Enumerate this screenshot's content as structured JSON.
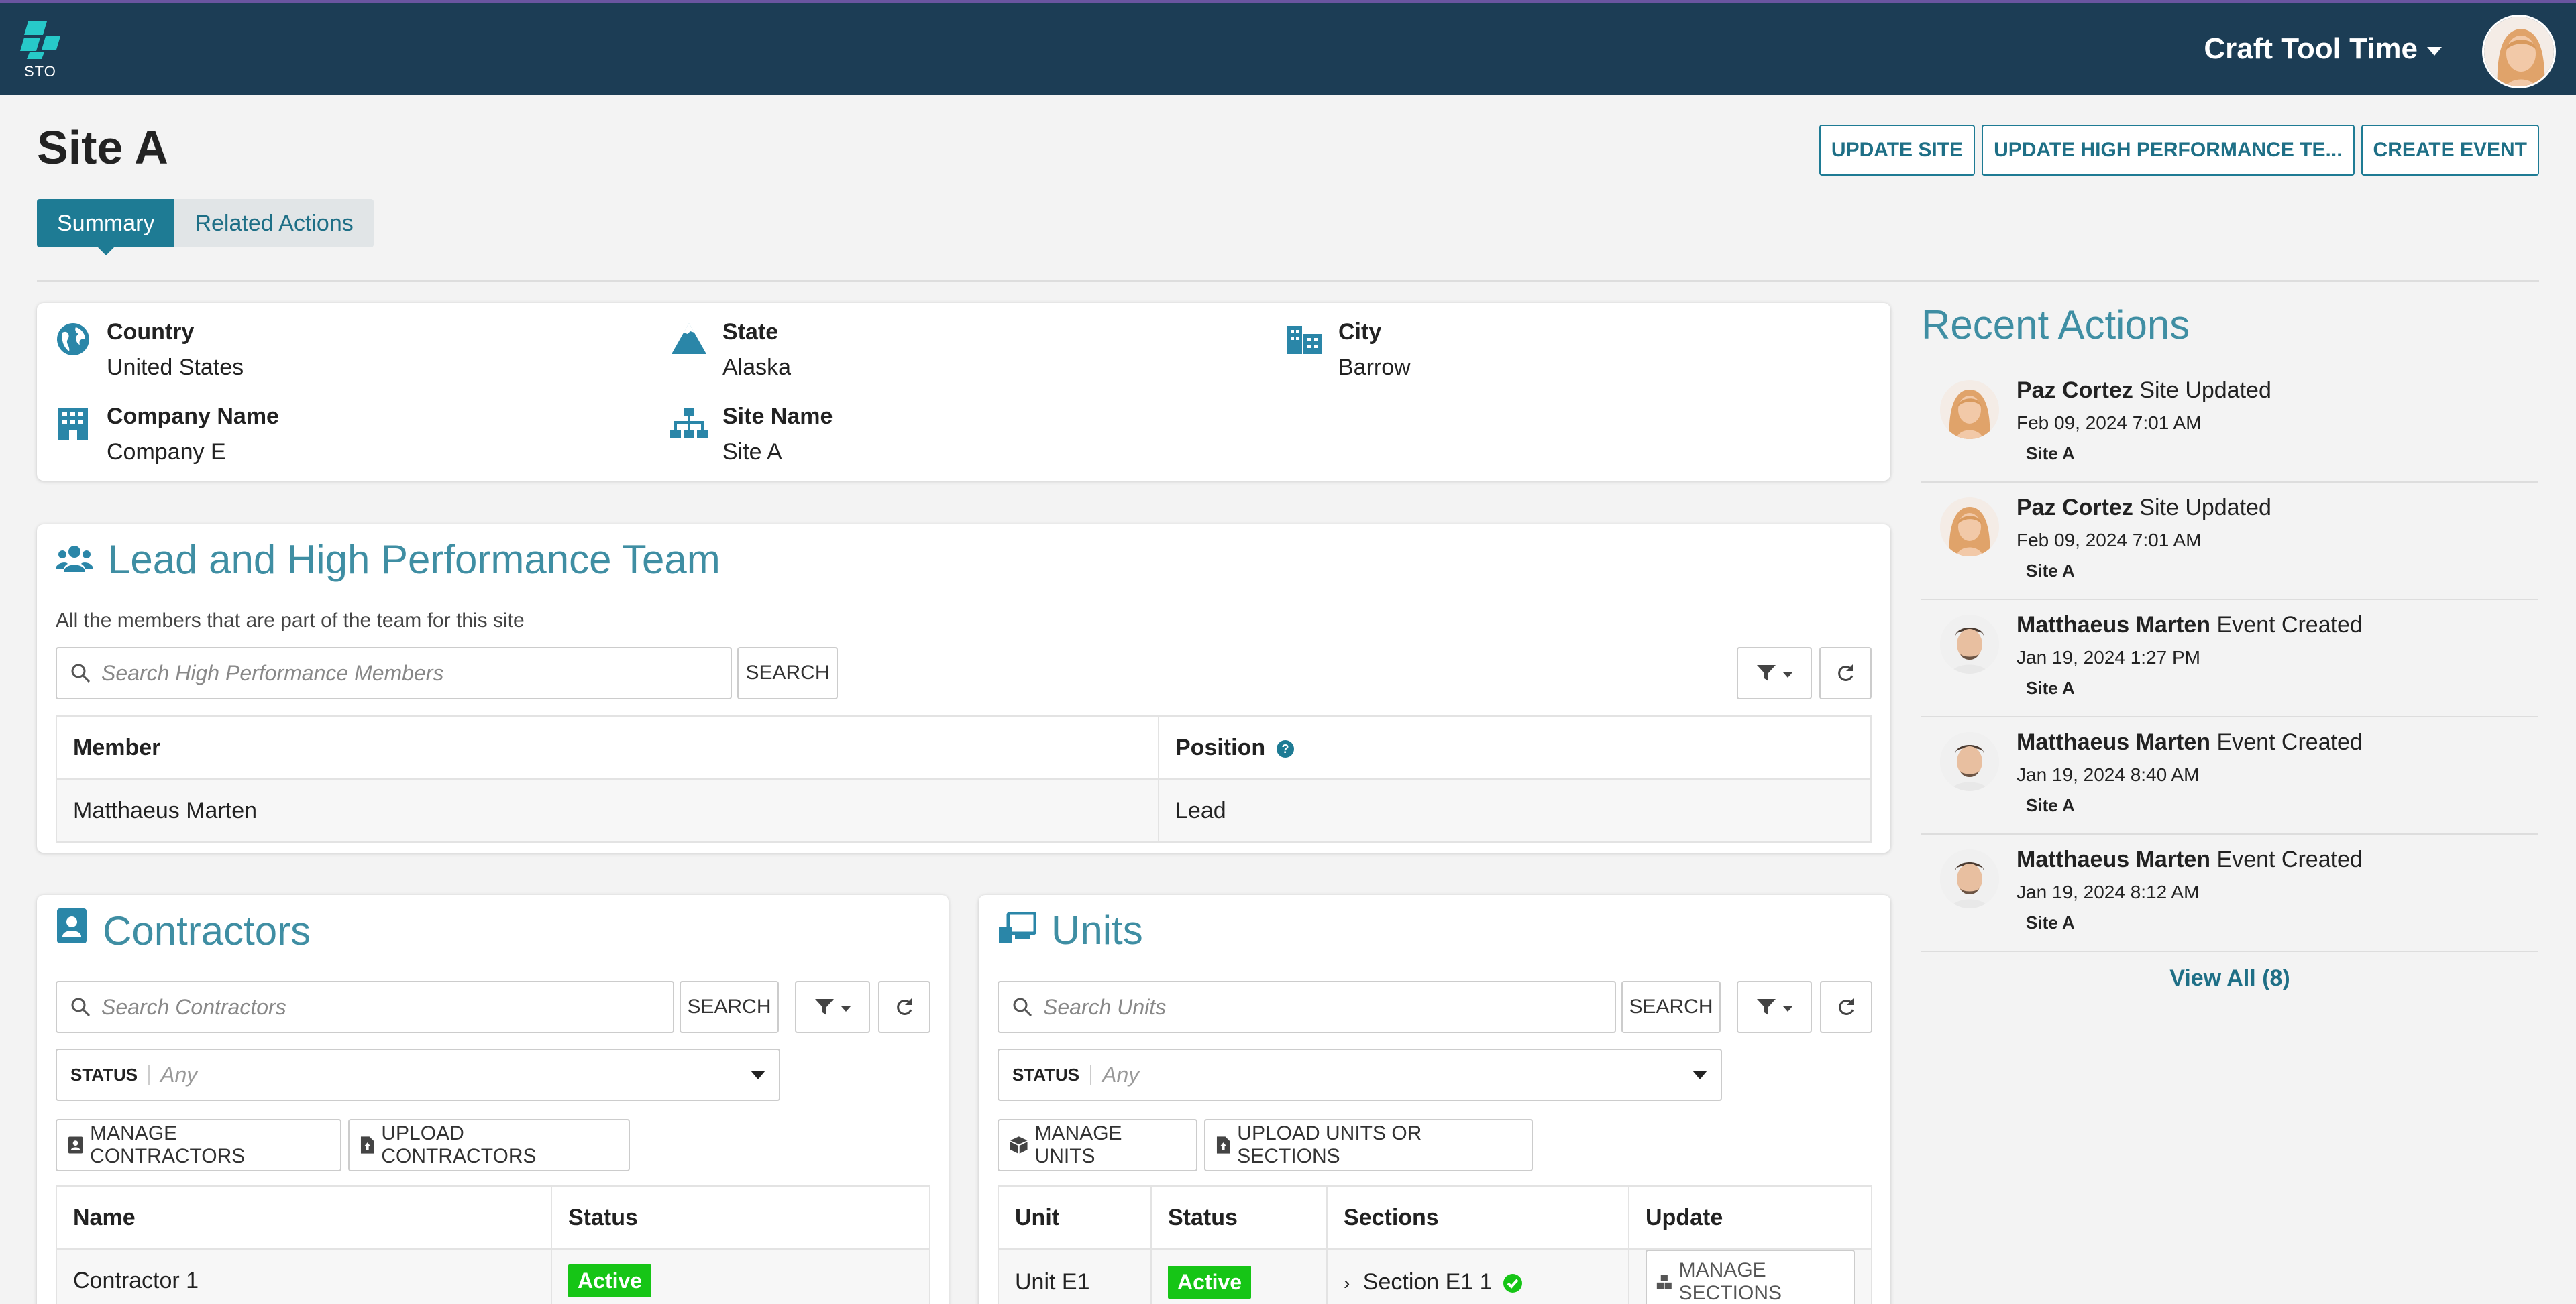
{
  "app": {
    "logo_text": "STO",
    "user_menu_label": "Craft Tool Time"
  },
  "page": {
    "title": "Site A",
    "buttons": {
      "update_site": "UPDATE SITE",
      "update_hpt": "UPDATE HIGH PERFORMANCE TE...",
      "create_event": "CREATE EVENT"
    },
    "tabs": [
      "Summary",
      "Related Actions"
    ]
  },
  "site_info": {
    "country": {
      "label": "Country",
      "value": "United States"
    },
    "state": {
      "label": "State",
      "value": "Alaska"
    },
    "city": {
      "label": "City",
      "value": "Barrow"
    },
    "company": {
      "label": "Company Name",
      "value": "Company E"
    },
    "site_name": {
      "label": "Site Name",
      "value": "Site A"
    }
  },
  "team": {
    "title": "Lead and High Performance Team",
    "subtitle": "All the members that are part of the team for this site",
    "search_placeholder": "Search High Performance Members",
    "search_button": "SEARCH",
    "columns": [
      "Member",
      "Position"
    ],
    "rows": [
      {
        "member": "Matthaeus Marten",
        "position": "Lead"
      }
    ]
  },
  "contractors": {
    "title": "Contractors",
    "search_placeholder": "Search Contractors",
    "search_button": "SEARCH",
    "status_label": "STATUS",
    "status_value": "Any",
    "manage_button": "MANAGE CONTRACTORS",
    "upload_button": "UPLOAD CONTRACTORS",
    "columns": [
      "Name",
      "Status"
    ],
    "rows": [
      {
        "name": "Contractor 1",
        "status": "Active"
      }
    ]
  },
  "units": {
    "title": "Units",
    "search_placeholder": "Search Units",
    "search_button": "SEARCH",
    "status_label": "STATUS",
    "status_value": "Any",
    "manage_button": "MANAGE UNITS",
    "upload_button": "UPLOAD UNITS OR SECTIONS",
    "columns": [
      "Unit",
      "Status",
      "Sections",
      "Update"
    ],
    "rows": [
      {
        "unit": "Unit E1",
        "status": "Active",
        "section": "Section E1 1",
        "update": "MANAGE SECTIONS"
      }
    ]
  },
  "recent_actions": {
    "title": "Recent Actions",
    "items": [
      {
        "actor": "Paz Cortez",
        "action": "Site Updated",
        "date": "Feb 09, 2024 7:01 AM",
        "site": "Site A",
        "avatar": "woman"
      },
      {
        "actor": "Paz Cortez",
        "action": "Site Updated",
        "date": "Feb 09, 2024 7:01 AM",
        "site": "Site A",
        "avatar": "woman"
      },
      {
        "actor": "Matthaeus Marten",
        "action": "Event Created",
        "date": "Jan 19, 2024 1:27 PM",
        "site": "Site A",
        "avatar": "man"
      },
      {
        "actor": "Matthaeus Marten",
        "action": "Event Created",
        "date": "Jan 19, 2024 8:40 AM",
        "site": "Site A",
        "avatar": "man"
      },
      {
        "actor": "Matthaeus Marten",
        "action": "Event Created",
        "date": "Jan 19, 2024 8:12 AM",
        "site": "Site A",
        "avatar": "man"
      }
    ],
    "view_all": "View All (8)"
  },
  "colors": {
    "topbar": "#1c3d55",
    "accent": "#1e7b94",
    "section_title": "#3f8ea3",
    "active_badge": "#16c516"
  }
}
